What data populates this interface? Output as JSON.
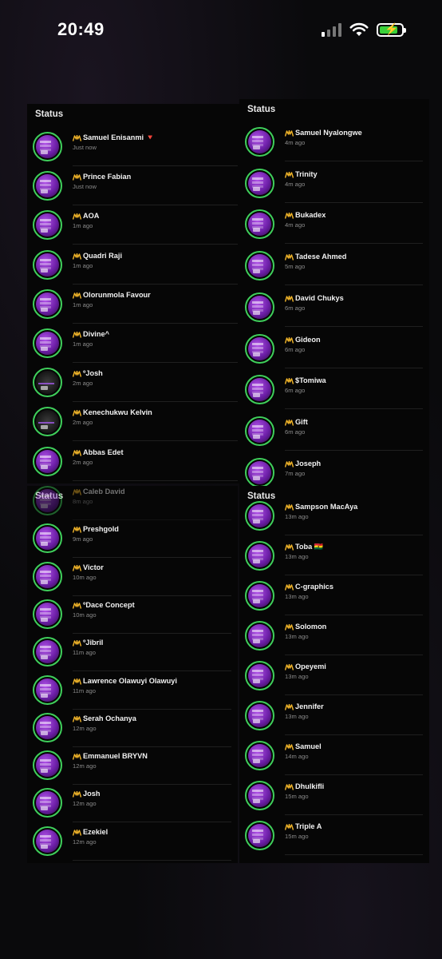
{
  "status_bar": {
    "time": "20:49",
    "icons": [
      "signal-icon",
      "wifi-icon",
      "battery-charging-icon"
    ]
  },
  "panels": [
    {
      "title": "Status",
      "items": [
        {
          "name": "Samuel Enisanmi 🔻",
          "time": "Just now"
        },
        {
          "name": "Prince Fabian",
          "time": "Just now"
        },
        {
          "name": "AOA",
          "time": "1m ago"
        },
        {
          "name": "Quadri Raji",
          "time": "1m ago"
        },
        {
          "name": "Olorunmola Favour",
          "time": "1m ago"
        },
        {
          "name": "Divine^",
          "time": "1m ago"
        },
        {
          "name": "ºJosh",
          "time": "2m ago"
        },
        {
          "name": "Kenechukwu Kelvin",
          "time": "2m ago"
        },
        {
          "name": "Abbas Edet",
          "time": "2m ago"
        }
      ]
    },
    {
      "title": "Status",
      "items": [
        {
          "name": "Samuel Nyalongwe",
          "time": "4m ago"
        },
        {
          "name": "Trinity",
          "time": "4m ago"
        },
        {
          "name": "Bukadex",
          "time": "4m ago"
        },
        {
          "name": "Tadese Ahmed",
          "time": "5m ago"
        },
        {
          "name": "David Chukys",
          "time": "6m ago"
        },
        {
          "name": "Gideon",
          "time": "6m ago"
        },
        {
          "name": "$Tomiwa",
          "time": "6m ago"
        },
        {
          "name": "Gift",
          "time": "6m ago"
        },
        {
          "name": "Joseph",
          "time": "7m ago"
        }
      ]
    },
    {
      "title": "Status",
      "items": [
        {
          "name": "Caleb David",
          "time": "8m ago"
        },
        {
          "name": "Preshgold",
          "time": "9m ago"
        },
        {
          "name": "Victor",
          "time": "10m ago"
        },
        {
          "name": "ºDace Concept",
          "time": "10m ago"
        },
        {
          "name": "ºJibril",
          "time": "11m ago"
        },
        {
          "name": "Lawrence Olawuyi Olawuyi",
          "time": "11m ago"
        },
        {
          "name": "Serah Ochanya",
          "time": "12m ago"
        },
        {
          "name": "Emmanuel BRYVN",
          "time": "12m ago"
        },
        {
          "name": "Josh",
          "time": "12m ago"
        },
        {
          "name": "Ezekiel",
          "time": "12m ago"
        }
      ]
    },
    {
      "title": "Status",
      "items": [
        {
          "name": "Sampson MacAya",
          "time": "13m ago"
        },
        {
          "name": "Toba 🇬🇭",
          "time": "13m ago"
        },
        {
          "name": "C-graphics",
          "time": "13m ago"
        },
        {
          "name": "Solomon",
          "time": "13m ago"
        },
        {
          "name": "Opeyemi",
          "time": "13m ago"
        },
        {
          "name": "Jennifer",
          "time": "13m ago"
        },
        {
          "name": "Samuel",
          "time": "14m ago"
        },
        {
          "name": "Dhulkifli",
          "time": "15m ago"
        },
        {
          "name": "Triple A",
          "time": "15m ago"
        }
      ]
    }
  ]
}
